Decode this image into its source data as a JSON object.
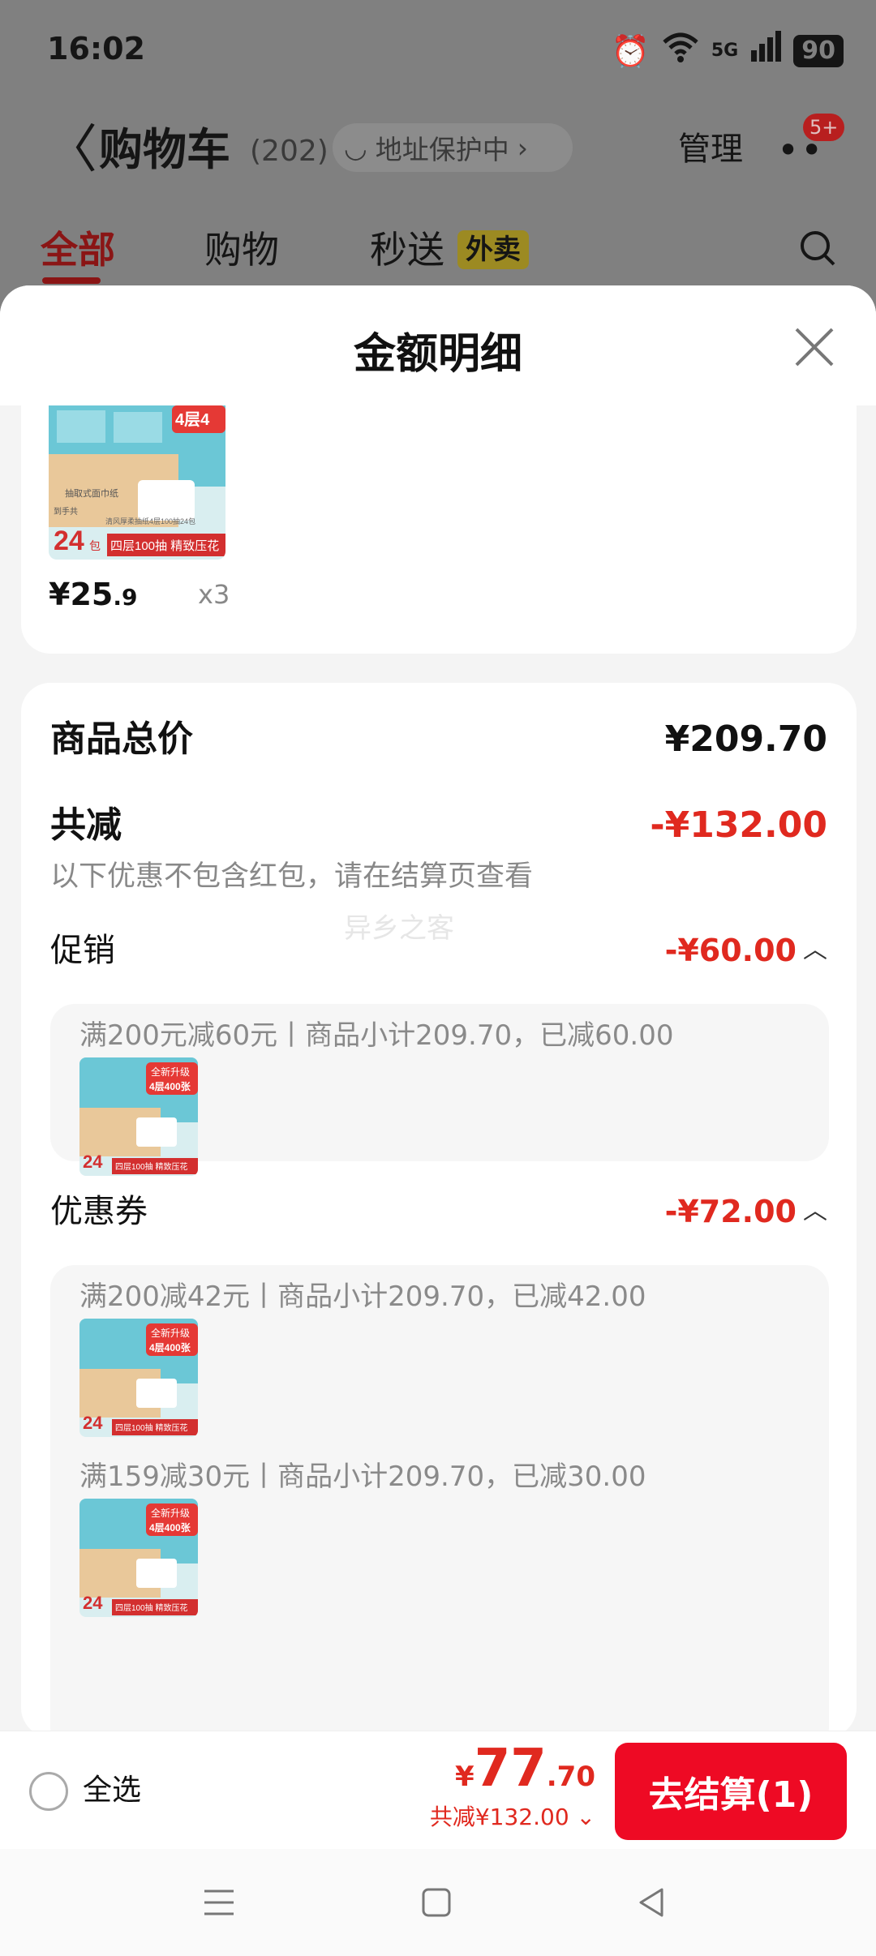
{
  "status_bar": {
    "time": "16:02",
    "alarm_icon": "⏰",
    "wifi_icon": "📶",
    "network": "5G",
    "signal_icon": "▮▮▮",
    "battery": "90"
  },
  "nav": {
    "back_icon": "〈",
    "title": "购物车",
    "count": "(202)",
    "address_icon": "◡",
    "address_protect": "地址保护中",
    "address_chevron": "›",
    "manage": "管理",
    "more_icon": "••",
    "more_badge": "5+"
  },
  "tabs": {
    "all": "全部",
    "shopping": "购物",
    "flash": "秒送",
    "takeaway_tag": "外卖"
  },
  "sheet": {
    "title": "金额明细"
  },
  "top_item": {
    "price_symbol": "¥",
    "price_int": "25",
    "price_dec": ".9",
    "quantity": "x3"
  },
  "product_image": {
    "label_top": "4层4",
    "box_text": "抽取式面巾纸",
    "desc": "清风厚柔抽纸4层100抽24包",
    "count_label": "到手共",
    "count": "24",
    "count_unit": "包",
    "banner": "四层100抽 精致压花",
    "upgrade": "全新升级",
    "upgrade_sub": "4层400张"
  },
  "summary": {
    "total_label": "商品总价",
    "total_value": "¥209.70",
    "discount_label": "共减",
    "discount_value": "-¥132.00",
    "note": "以下优惠不包含红包，请在结算页查看",
    "watermark": "异乡之客"
  },
  "promotion": {
    "label": "促销",
    "value": "-¥60.00",
    "chevron": "︿",
    "detail": "满200元减60元丨商品小计209.70，已减60.00"
  },
  "coupon": {
    "label": "优惠券",
    "value": "-¥72.00",
    "chevron": "︿",
    "details": [
      "满200减42元丨商品小计209.70，已减42.00",
      "满159减30元丨商品小计209.70，已减30.00"
    ]
  },
  "bottom_bar": {
    "select_all": "全选",
    "price_symbol": "¥",
    "price_int": "77",
    "price_dec": ".70",
    "total_discount": "共减¥132.00 ⌄",
    "checkout": "去结算(1)"
  },
  "colors": {
    "accent_red": "#e0291f",
    "button_red": "#ee0a24"
  }
}
